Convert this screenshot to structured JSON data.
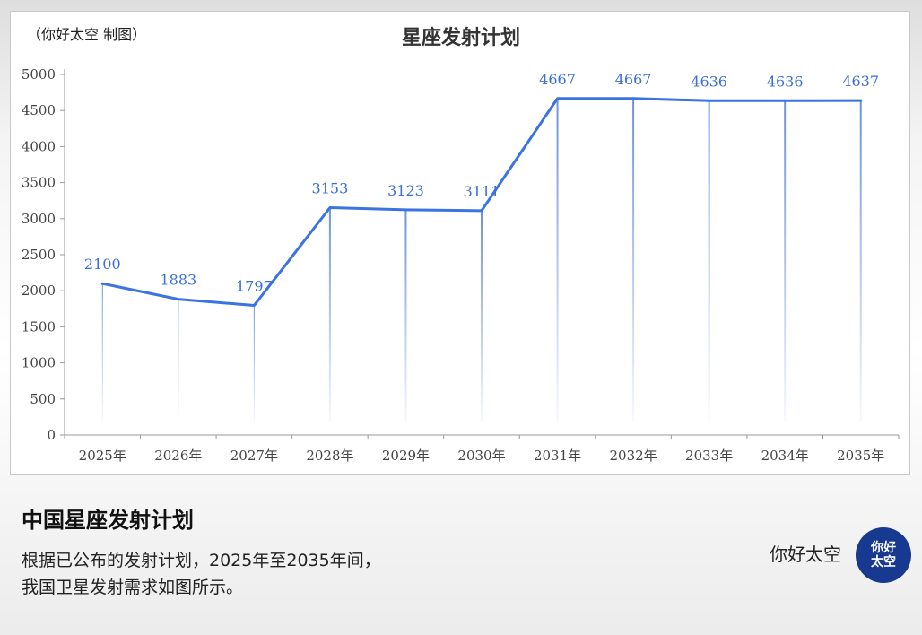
{
  "credit": "（你好太空 制图）",
  "chart_data": {
    "type": "line",
    "title": "星座发射计划",
    "categories": [
      "2025年",
      "2026年",
      "2027年",
      "2028年",
      "2029年",
      "2030年",
      "2031年",
      "2032年",
      "2033年",
      "2034年",
      "2035年"
    ],
    "values": [
      2100,
      1883,
      1797,
      3153,
      3123,
      3111,
      4667,
      4667,
      4636,
      4636,
      4637
    ],
    "ylim": [
      0,
      5000
    ],
    "yticks": [
      0,
      500,
      1000,
      1500,
      2000,
      2500,
      3000,
      3500,
      4000,
      4500,
      5000
    ],
    "xlabel": "",
    "ylabel": "",
    "grid": false,
    "data_labels": true,
    "line_color": "#3b73e0",
    "label_color": "#3a6fd8"
  },
  "caption": {
    "title": "中国星座发射计划",
    "line1": "根据已公布的发射计划，2025年至2035年间，",
    "line2": "我国卫星发射需求如图所示。"
  },
  "brand": {
    "name": "你好太空",
    "logo_text": [
      "你好",
      "太空"
    ],
    "logo_color": "#17398f"
  }
}
